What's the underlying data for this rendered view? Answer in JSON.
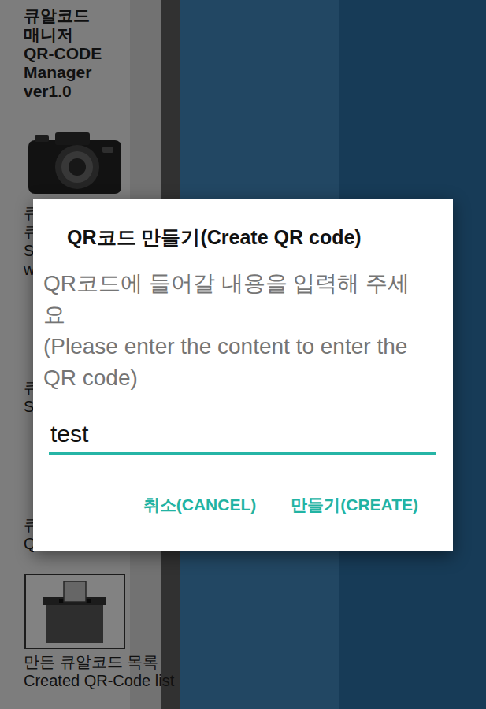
{
  "app": {
    "title_lines": [
      "큐알코드",
      "매니저",
      "QR-CODE",
      "Manager",
      "ver1.0"
    ]
  },
  "menu": [
    {
      "kind": "camera",
      "label_lines": [
        "큐",
        "큐",
        "S",
        "w"
      ]
    },
    {
      "kind": "hidden",
      "label_lines": [
        "큐",
        "S"
      ]
    },
    {
      "kind": "hidden",
      "label_lines": [
        "큐",
        "Q"
      ]
    },
    {
      "kind": "box",
      "label_lines": [
        "만든 큐알코드 목록",
        "Created QR-Code list"
      ]
    }
  ],
  "dialog": {
    "title": "QR코드 만들기(Create QR code)",
    "message_lines": [
      "QR코드에 들어갈 내용을 입력해 주세요",
      "(Please enter the content to enter the QR code)"
    ],
    "input_value": "test",
    "buttons": [
      "취소(CANCEL)",
      "만들기(CREATE)"
    ]
  }
}
